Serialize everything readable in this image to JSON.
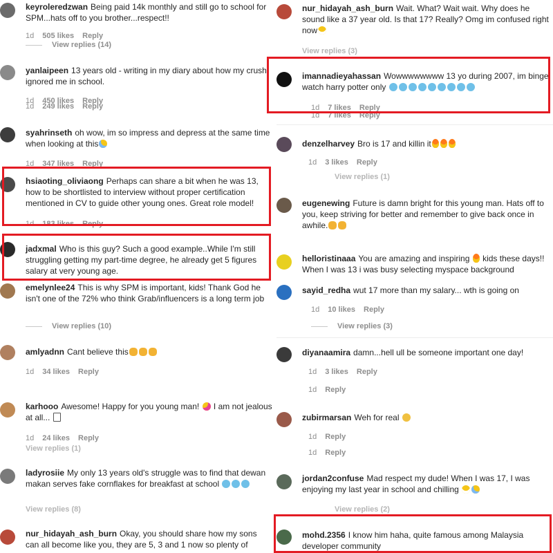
{
  "left": [
    {
      "user": "keyroleredzwan",
      "text": "Being paid 14k monthly and still go to school for SPM...hats off to you brother...respect!!",
      "emoji": [],
      "time": "1d",
      "likes": "505 likes",
      "reply": "Reply",
      "view": "View replies (14)",
      "avatar": "#6b6b6b"
    },
    {
      "user": "yanlaipeen",
      "text": "13 years old - writing in my diary about how my crush ignored me in school.",
      "emoji": [],
      "time": "1d",
      "likes": "450 likes",
      "likes2": "249 likes",
      "reply": "Reply",
      "avatar": "#8a8a8a"
    },
    {
      "user": "syahrinseth",
      "text": "oh wow, im so impress and depress at the same time when looking at this",
      "emoji": [
        "sweat"
      ],
      "time": "1d",
      "likes": "347 likes",
      "reply": "Reply",
      "avatar": "#3d3d3d"
    },
    {
      "user": "hsiaoting_oliviaong",
      "text": "Perhaps can share a bit when he was 13, how to be shortlisted to interview without proper certification mentioned in CV to guide other young ones. Great role model!",
      "emoji": [],
      "time": "1d",
      "likes": "183 likes",
      "reply": "Reply",
      "avatar": "#4a4a4a"
    },
    {
      "user": "jadxmal",
      "text": "Who is this guy? Such a good example..While I'm still struggling getting my part-time degree, he already get 5 figures salary at very young age.",
      "emoji": [],
      "avatar": "#2a2a2a"
    },
    {
      "user": "emelynlee24",
      "text": "This is why SPM is important, kids! Thank God he isn't one of the 72% who think Grab/influencers is a long term job",
      "emoji": [],
      "view": "View replies (10)",
      "avatar": "#a07850"
    },
    {
      "user": "amlyadnn",
      "text": "Cant believe this",
      "emoji": [
        "clap",
        "clap",
        "clap"
      ],
      "time": "1d",
      "likes": "34 likes",
      "reply": "Reply",
      "avatar": "#b08060"
    },
    {
      "user": "karhooo",
      "text": "Awesome! Happy for you young man!",
      "text2": "I am not jealous at all...",
      "emoji": [
        "party"
      ],
      "emoji2": [
        "box"
      ],
      "time": "1d",
      "likes": "24 likes",
      "reply": "Reply",
      "view": "View replies (1)",
      "avatar": "#c08a55"
    },
    {
      "user": "ladyrosiie",
      "text": "My only 13 years old's struggle was to find that dewan makan serves fake cornflakes for breakfast at school",
      "emoji": [
        "cry",
        "cry",
        "cry"
      ],
      "view": "View replies (8)",
      "avatar": "#7a7a7a"
    },
    {
      "user": "nur_hidayah_ash_burn",
      "text": "Okay, you should share how my sons can all become like you, they are 5, 3 and 1 now so plenty of",
      "emoji": [],
      "avatar": "#b84a3a"
    }
  ],
  "right": [
    {
      "user": "nur_hidayah_ash_burn",
      "text": "Wait. What? Wait wait. Why does he sound like a 37 year old. Is that 17? Really? Omg im confused right now",
      "emoji": [
        "grin"
      ],
      "view": "View replies (3)",
      "avatar": "#b84a3a"
    },
    {
      "user": "imannadieyahassan",
      "text": "Wowwwwwwww 13 yo during 2007, im binge watch harry potter only",
      "emoji": [
        "cry",
        "cry",
        "cry",
        "cry",
        "cry",
        "cry",
        "cry",
        "cry",
        "cry"
      ],
      "time": "1d",
      "likes": "7 likes",
      "reply": "Reply",
      "avatar": "#111111"
    },
    {
      "user": "denzelharvey",
      "text": "Bro is 17 and killin it",
      "emoji": [
        "fire",
        "fire",
        "fire"
      ],
      "time": "1d",
      "likes": "3 likes",
      "reply": "Reply",
      "view": "View replies (1)",
      "avatar": "#5a4a5a"
    },
    {
      "user": "eugenewing",
      "text": "Future is damn bright for this young man. Hats off to you, keep striving for better and remember to give back once in awhile.",
      "emoji": [
        "clap",
        "clap"
      ],
      "avatar": "#6a5a4a"
    },
    {
      "user": "helloristinaaa",
      "text": "You are amazing and inspiring",
      "text2": "kids these days!! When I was 13 i was busy selecting myspace background",
      "emoji": [
        "fire"
      ],
      "avatar": "#e8d020"
    },
    {
      "user": "sayid_redha",
      "text": "wut 17 more than my salary... wth is going on",
      "emoji": [],
      "time": "1d",
      "likes": "10 likes",
      "reply": "Reply",
      "view": "View replies (3)",
      "avatar": "#2a70c0"
    },
    {
      "user": "diyanaamira",
      "text": "damn...hell ull be someone important one day!",
      "emoji": [],
      "time": "1d",
      "likes": "3 likes",
      "reply": "Reply",
      "time2": "1d",
      "reply2": "Reply",
      "avatar": "#3a3a3a"
    },
    {
      "user": "zubirmarsan",
      "text": "Weh for real",
      "emoji": [
        "sad"
      ],
      "time": "1d",
      "reply": "Reply",
      "time2": "1d",
      "reply2": "Reply",
      "avatar": "#9a5a4a"
    },
    {
      "user": "jordan2confuse",
      "text": "Mad respect my dude! When I was 17, I was enjoying my last year in school and chilling",
      "emoji": [
        "grin",
        "sweat"
      ],
      "view": "View replies (2)",
      "avatar": "#5a6a5a"
    },
    {
      "user": "mohd.2356",
      "text": "I know him haha, quite famous among Malaysia developer community",
      "emoji": [],
      "avatar": "#4a6a4a"
    }
  ],
  "highlight_color": "#e31b23"
}
